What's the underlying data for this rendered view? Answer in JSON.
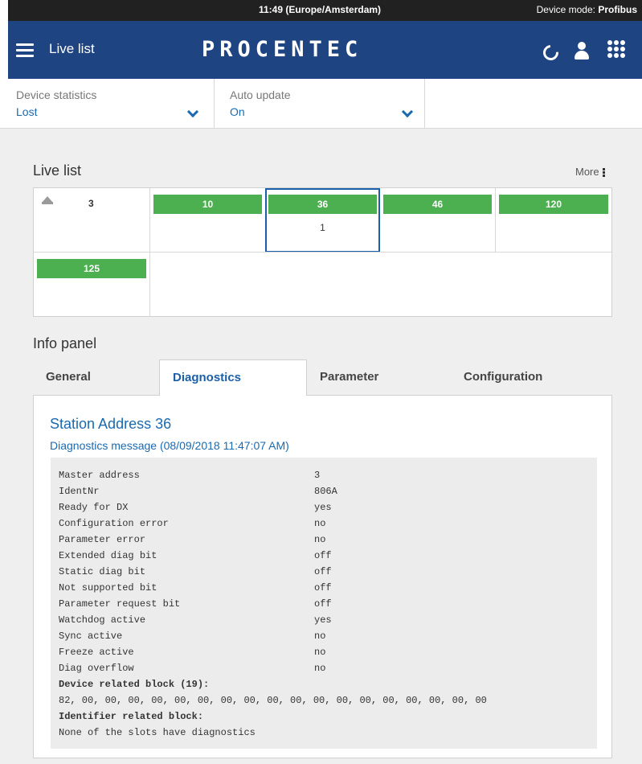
{
  "status": {
    "time": "11:49 (Europe/Amsterdam)",
    "mode_label": "Device mode:",
    "mode_value": "Profibus"
  },
  "header": {
    "title": "Live list",
    "logo": "PROCENTEC"
  },
  "filters": [
    {
      "label": "Device statistics",
      "value": "Lost"
    },
    {
      "label": "Auto update",
      "value": "On"
    }
  ],
  "live_list": {
    "title": "Live list",
    "more": "More",
    "master": "3",
    "stations": [
      {
        "addr": "10",
        "sub": ""
      },
      {
        "addr": "36",
        "sub": "1"
      },
      {
        "addr": "46",
        "sub": ""
      },
      {
        "addr": "120",
        "sub": ""
      },
      {
        "addr": "125",
        "sub": ""
      }
    ]
  },
  "info_panel": {
    "title": "Info panel",
    "tabs": [
      "General",
      "Diagnostics",
      "Parameter",
      "Configuration"
    ],
    "active_tab": "Diagnostics",
    "station_address": "Station Address 36",
    "diag_message": "Diagnostics message (08/09/2018 11:47:07 AM)",
    "rows": [
      {
        "key": "Master address",
        "value": "3"
      },
      {
        "key": "IdentNr",
        "value": "806A"
      },
      {
        "key": "Ready for DX",
        "value": "yes"
      },
      {
        "key": "Configuration error",
        "value": "no"
      },
      {
        "key": "Parameter error",
        "value": "no"
      },
      {
        "key": "Extended diag bit",
        "value": "off"
      },
      {
        "key": "Static diag bit",
        "value": "off"
      },
      {
        "key": "Not supported bit",
        "value": "off"
      },
      {
        "key": "Parameter request bit",
        "value": "off"
      },
      {
        "key": "Watchdog active",
        "value": "yes"
      },
      {
        "key": "Sync active",
        "value": "no"
      },
      {
        "key": "Freeze active",
        "value": "no"
      },
      {
        "key": "Diag overflow",
        "value": "no"
      }
    ],
    "device_block_heading": "Device related block (19):",
    "device_block_bytes": "82, 00, 00, 00, 00, 00, 00, 00, 00, 00, 00, 00, 00, 00, 00, 00, 00, 00, 00",
    "identifier_block_heading": "Identifier related block:",
    "identifier_block_text": "None of the slots have diagnostics"
  }
}
